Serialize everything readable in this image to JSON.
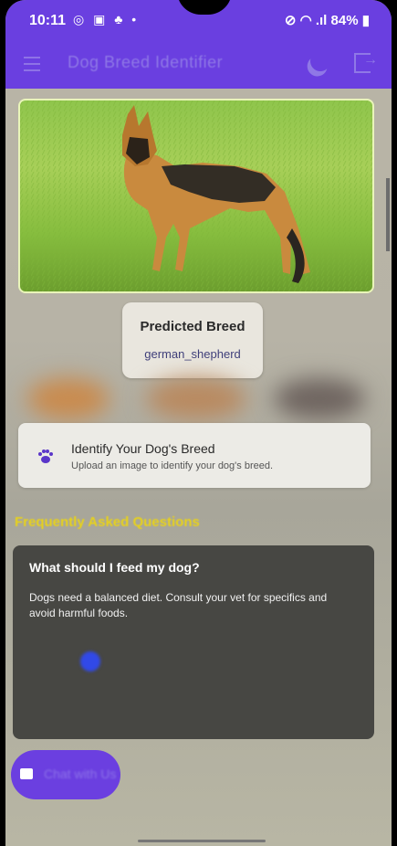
{
  "status_bar": {
    "time": "10:11",
    "left_icons": "◎ ▣ ♣ •",
    "right_text": "84%",
    "right_icons": "⊘ ◠ .ıl"
  },
  "app_bar": {
    "title": "Dog Breed Identifier",
    "accent_color": "#6a3fe0"
  },
  "prediction": {
    "title": "Predicted Breed",
    "value": "german_shepherd"
  },
  "identify": {
    "title": "Identify Your Dog's Breed",
    "subtitle": "Upload an image to identify your dog's breed."
  },
  "faq": {
    "heading": "Frequently Asked Questions",
    "heading_color": "#e8d21a",
    "question": "What should I feed my dog?",
    "answer": "Dogs need a balanced diet. Consult your vet for specifics and avoid harmful foods."
  },
  "chat_button": {
    "label": "Chat with Us",
    "icon": "chat-icon"
  }
}
